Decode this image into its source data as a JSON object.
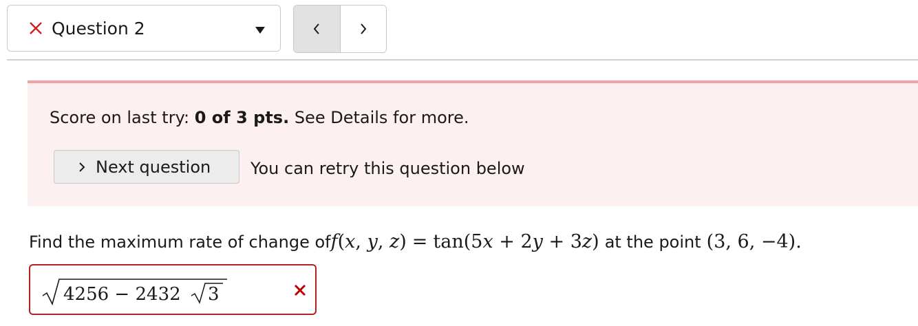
{
  "question_nav": {
    "selected_label": "Question 2",
    "status_icon": "x-icon",
    "status_color": "#cc1f1f",
    "prev_label": "<",
    "next_label": ">"
  },
  "feedback": {
    "score_prefix": "Score on last try: ",
    "score_value": "0 of 3 pts.",
    "score_suffix": " See Details for more.",
    "next_question_label": "Next question",
    "retry_message": "You can retry this question below"
  },
  "question": {
    "prefix": "Find the maximum rate of change of ",
    "function_lhs": "f(x, y, z)",
    "equals": "=",
    "function_rhs": "tan(5x + 2y + 3z)",
    "middle": "at the point",
    "point": "(3, 6, −4).",
    "answer_outer": "4256 − 2432",
    "answer_inner": "3",
    "answer_status": "incorrect"
  },
  "colors": {
    "panel_bg": "#fdf0f0",
    "panel_border": "#f2a3a3",
    "answer_border": "#b32020",
    "wrong_mark": "#b80000"
  }
}
